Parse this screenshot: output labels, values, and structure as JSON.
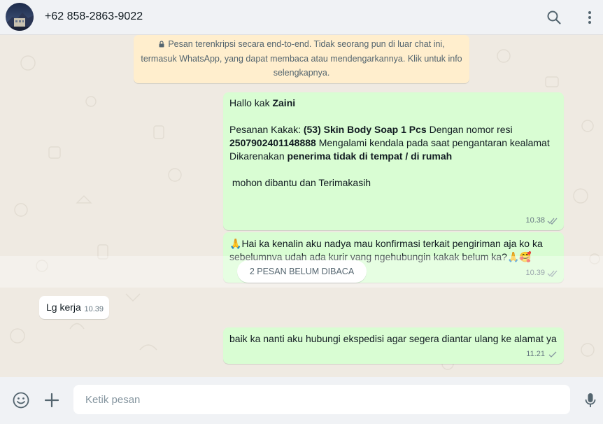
{
  "header": {
    "contact_name": "+62 858-2863-9022",
    "icons": [
      "search-icon",
      "menu-dots-icon"
    ]
  },
  "encryption_notice": {
    "line1": "Pesan terenkripsi secara end-to-end. Tidak seorang pun di luar chat ini,",
    "line2": "termasuk WhatsApp, yang dapat membaca atau mendengarkannya. Klik untuk info",
    "line3": "selengkapnya."
  },
  "messages": [
    {
      "direction": "out",
      "greeting_prefix": "Hallo kak ",
      "greeting_name": "Zaini",
      "order_prefix": "Pesanan Kakak: ",
      "order_item": "(53) Skin Body Soap 1 Pcs",
      "order_mid": " Dengan nomor resi",
      "resi": "2507902401148888",
      "delivery_text": " Mengalami kendala pada saat pengantaran kealamat",
      "reason_prefix": "Dikarenakan ",
      "reason": "penerima tidak di tempat / di rumah",
      "closing": " mohon dibantu dan Terimakasih",
      "time": "10.38",
      "status": "read"
    },
    {
      "direction": "out",
      "emoji_start": "🙏",
      "text_line1": "Hai ka kenalin aku nadya mau konfirmasi terkait pengiriman aja ko ka",
      "text_line2": "sebelumnya udah ada kurir yang ngehubungin kakak belum ka?",
      "emoji_end": "🙏🥰",
      "time": "10.39",
      "status": "read"
    },
    {
      "direction": "in",
      "text": "Lg kerja",
      "time": "10.39"
    },
    {
      "direction": "out",
      "text": "baik ka nanti aku hubungi ekspedisi agar segera diantar ulang ke alamat ya",
      "time": "11.21",
      "status": "sent"
    }
  ],
  "unread_divider": "2 PESAN BELUM DIBACA",
  "footer": {
    "input_placeholder": "Ketik pesan",
    "icons": [
      "emoji-icon",
      "plus-icon",
      "mic-icon"
    ]
  },
  "colors": {
    "outgoing_bubble": "#d9fdd3",
    "incoming_bubble": "#ffffff",
    "chat_background": "#efeae2",
    "notice_background": "#ffeecd",
    "read_tick": "#8696a0"
  }
}
